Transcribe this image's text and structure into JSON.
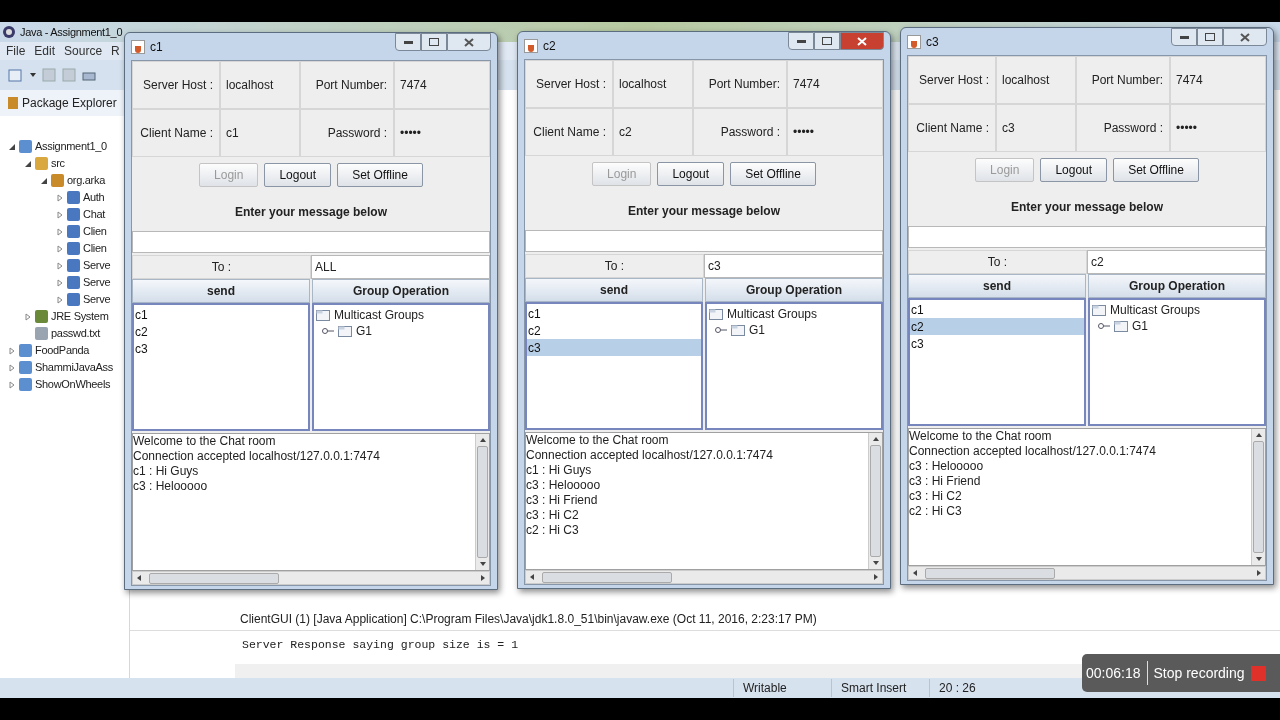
{
  "ide": {
    "title": "Java - Assignment1_0",
    "menu": [
      "File",
      "Edit",
      "Source",
      "R"
    ],
    "explorer_title": "Package Explorer",
    "tree": [
      {
        "label": "Assignment1_0",
        "kind": "project",
        "expanded": true,
        "children": [
          {
            "label": "src",
            "kind": "source",
            "expanded": true,
            "children": [
              {
                "label": "org.arka",
                "kind": "package",
                "expanded": true,
                "children": [
                  {
                    "label": "Auth",
                    "kind": "class",
                    "expanded": false
                  },
                  {
                    "label": "Chat",
                    "kind": "class",
                    "expanded": false
                  },
                  {
                    "label": "Clien",
                    "kind": "class",
                    "expanded": false
                  },
                  {
                    "label": "Clien",
                    "kind": "class",
                    "expanded": false
                  },
                  {
                    "label": "Serve",
                    "kind": "class",
                    "expanded": false
                  },
                  {
                    "label": "Serve",
                    "kind": "class",
                    "expanded": false
                  },
                  {
                    "label": "Serve",
                    "kind": "class",
                    "expanded": false
                  }
                ]
              }
            ]
          },
          {
            "label": "JRE System",
            "kind": "library",
            "expanded": false
          },
          {
            "label": "passwd.txt",
            "kind": "file"
          }
        ]
      },
      {
        "label": "FoodPanda",
        "kind": "project",
        "expanded": false
      },
      {
        "label": "ShammiJavaAss",
        "kind": "project",
        "expanded": false
      },
      {
        "label": "ShowOnWheels",
        "kind": "project",
        "expanded": false
      }
    ],
    "console_header": "ClientGUI (1) [Java Application] C:\\Program Files\\Java\\jdk1.8.0_51\\bin\\javaw.exe (Oct 11, 2016, 2:23:17 PM)",
    "console_output": "Server Response saying group size is = 1",
    "status": [
      "Writable",
      "Smart Insert",
      "20 : 26"
    ]
  },
  "windows": [
    {
      "title": "c1",
      "active": false,
      "server_host_label": "Server Host :",
      "server_host": "localhost",
      "port_label": "Port Number:",
      "port": "7474",
      "client_name_label": "Client Name :",
      "client_name": "c1",
      "password_label": "Password :",
      "password": "•••••",
      "buttons": [
        {
          "label": "Login",
          "disabled": true
        },
        {
          "label": "Logout",
          "disabled": false
        },
        {
          "label": "Set Offline",
          "disabled": false
        }
      ],
      "message_label": "Enter your message below",
      "to_label": "To :",
      "to": "ALL",
      "send": "send",
      "group_operation": "Group Operation",
      "clients": [
        {
          "name": "c1",
          "selected": false
        },
        {
          "name": "c2",
          "selected": false
        },
        {
          "name": "c3",
          "selected": false
        }
      ],
      "groups": {
        "label": "Multicast Groups",
        "children": [
          {
            "label": "G1",
            "expanded": false
          }
        ]
      },
      "log": [
        "Welcome to the Chat room",
        "Connection accepted localhost/127.0.0.1:7474",
        "c1 : Hi Guys",
        "c3 : Helooooo"
      ]
    },
    {
      "title": "c2",
      "active": true,
      "server_host_label": "Server Host :",
      "server_host": "localhost",
      "port_label": "Port Number:",
      "port": "7474",
      "client_name_label": "Client Name :",
      "client_name": "c2",
      "password_label": "Password :",
      "password": "•••••",
      "buttons": [
        {
          "label": "Login",
          "disabled": true
        },
        {
          "label": "Logout",
          "disabled": false
        },
        {
          "label": "Set Offline",
          "disabled": false
        }
      ],
      "message_label": "Enter your message below",
      "to_label": "To :",
      "to": "c3",
      "send": "send",
      "group_operation": "Group Operation",
      "clients": [
        {
          "name": "c1",
          "selected": false
        },
        {
          "name": "c2",
          "selected": false
        },
        {
          "name": "c3",
          "selected": true
        }
      ],
      "groups": {
        "label": "Multicast Groups",
        "children": [
          {
            "label": "G1",
            "expanded": false
          }
        ]
      },
      "log": [
        "Welcome to the Chat room",
        "Connection accepted localhost/127.0.0.1:7474",
        "c1 : Hi Guys",
        "c3 : Helooooo",
        "c3 : Hi Friend",
        "c3 : Hi C2",
        "c2 : Hi C3"
      ]
    },
    {
      "title": "c3",
      "active": false,
      "server_host_label": "Server Host :",
      "server_host": "localhost",
      "port_label": "Port Number:",
      "port": "7474",
      "client_name_label": "Client Name :",
      "client_name": "c3",
      "password_label": "Password :",
      "password": "•••••",
      "buttons": [
        {
          "label": "Login",
          "disabled": true
        },
        {
          "label": "Logout",
          "disabled": false
        },
        {
          "label": "Set Offline",
          "disabled": false
        }
      ],
      "message_label": "Enter your message below",
      "to_label": "To :",
      "to": "c2",
      "send": "send",
      "group_operation": "Group Operation",
      "clients": [
        {
          "name": "c1",
          "selected": false
        },
        {
          "name": "c2",
          "selected": true
        },
        {
          "name": "c3",
          "selected": false
        }
      ],
      "groups": {
        "label": "Multicast Groups",
        "children": [
          {
            "label": "G1",
            "expanded": false
          }
        ]
      },
      "log": [
        "Welcome to the Chat room",
        "Connection accepted localhost/127.0.0.1:7474",
        "c3 : Helooooo",
        "c3 : Hi Friend",
        "c3 : Hi C2",
        "c2 : Hi C3"
      ]
    }
  ],
  "recording": {
    "time": "00:06:18",
    "label": "Stop recording"
  }
}
